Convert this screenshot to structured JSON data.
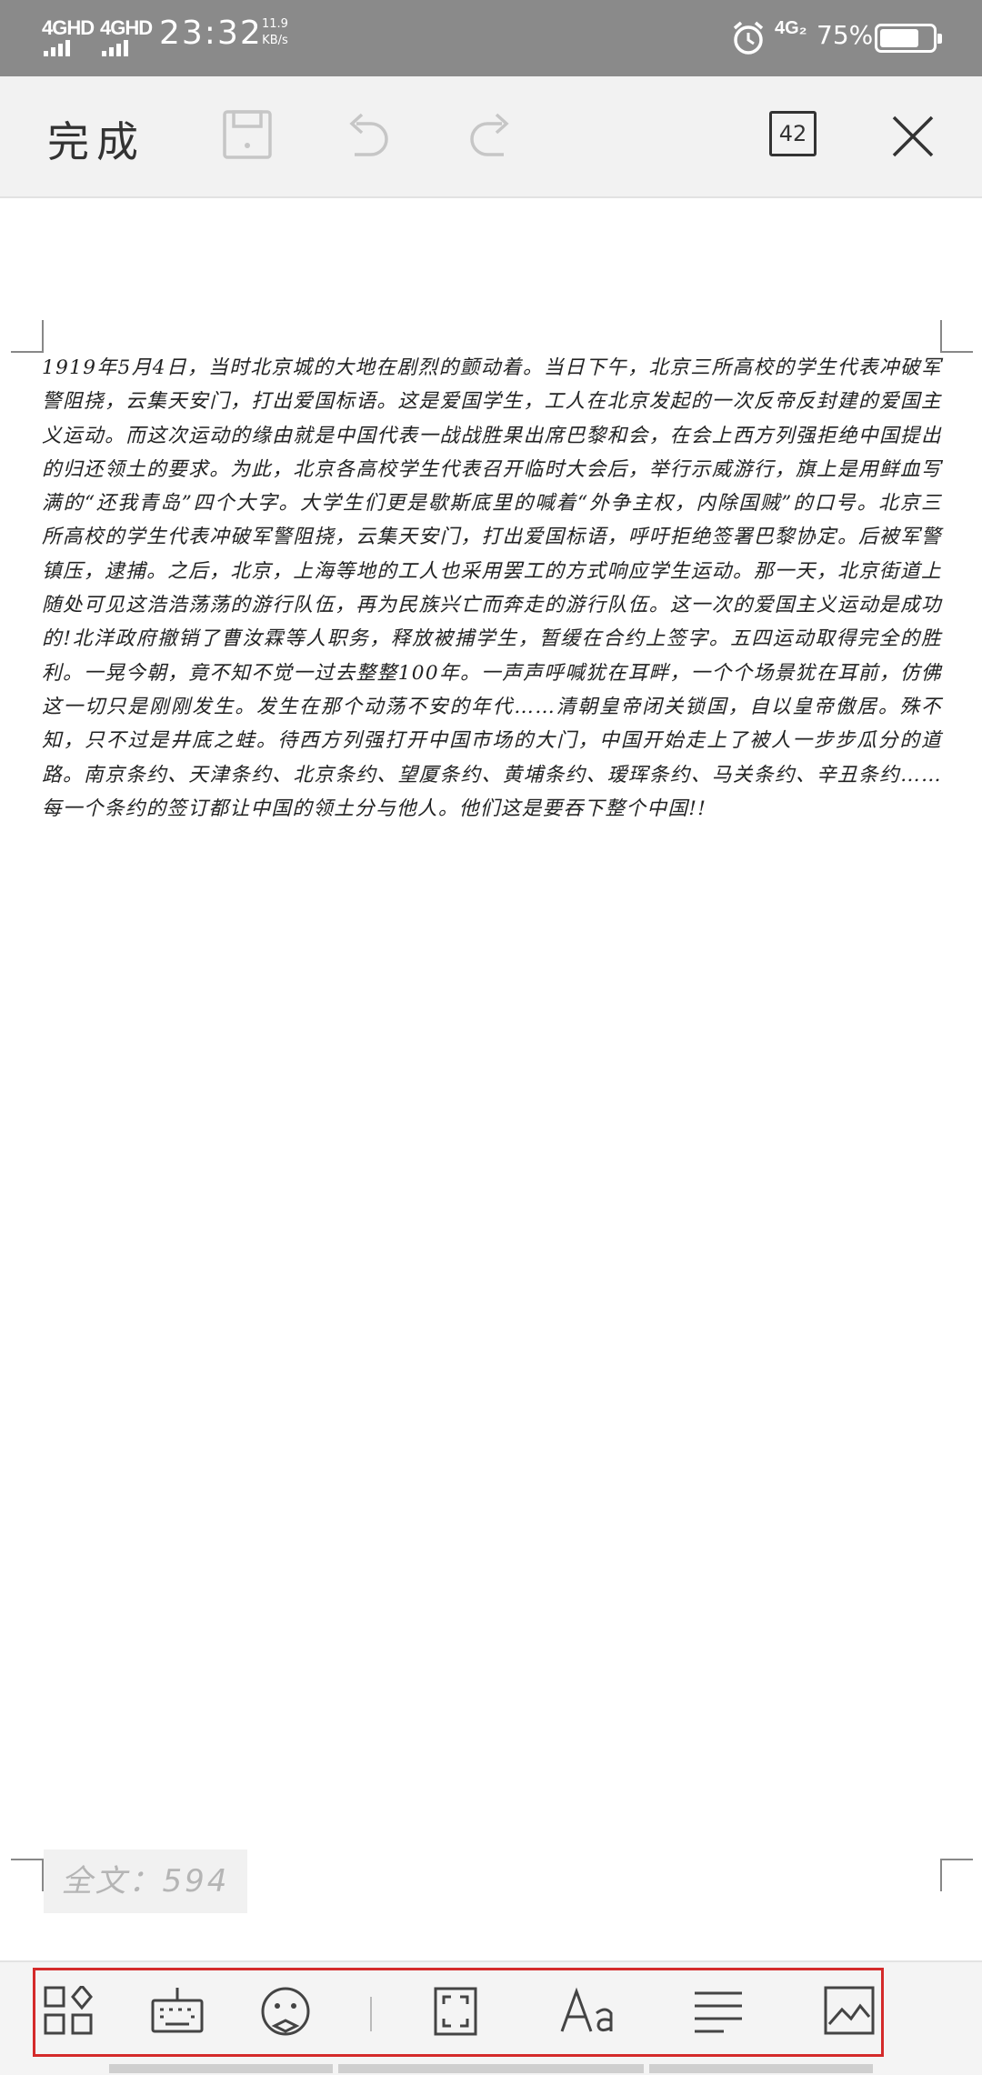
{
  "status_bar": {
    "net1": "4GHD",
    "net2": "4GHD",
    "time": "23:32",
    "speed_value": "11.9",
    "speed_unit": "KB/s",
    "sim2": "4G₂",
    "battery_text": "75%",
    "battery_level": 0.75
  },
  "toolbar": {
    "done_label": "完成",
    "count": "42"
  },
  "document": {
    "body": "1919年5月4日，当时北京城的大地在剧烈的颤动着。当日下午，北京三所高校的学生代表冲破军警阻挠，云集天安门，打出爱国标语。这是爱国学生，工人在北京发起的一次反帝反封建的爱国主义运动。而这次运动的缘由就是中国代表一战战胜果出席巴黎和会，在会上西方列强拒绝中国提出的归还领土的要求。为此，北京各高校学生代表召开临时大会后，举行示威游行，旗上是用鲜血写满的“还我青岛”四个大字。大学生们更是歇斯底里的喊着“外争主权，内除国贼”的口号。北京三所高校的学生代表冲破军警阻挠，云集天安门，打出爱国标语，呼吁拒绝签署巴黎协定。后被军警镇压，逮捕。之后，北京，上海等地的工人也采用罢工的方式响应学生运动。那一天，北京街道上随处可见这浩浩荡荡的游行队伍，再为民族兴亡而奔走的游行队伍。这一次的爱国主义运动是成功的!北洋政府撤销了曹汝霖等人职务，释放被捕学生，暂缓在合约上签字。五四运动取得完全的胜利。一晃今朝，竟不知不觉一过去整整100年。一声声呼喊犹在耳畔，一个个场景犹在耳前，仿佛这一切只是刚刚发生。发生在那个动荡不安的年代……清朝皇帝闭关锁国，自以皇帝傲居。殊不知，只不过是井底之蛙。待西方列强打开中国市场的大门，中国开始走上了被人一步步瓜分的道路。南京条约、天津条约、北京条约、望厦条约、黄埔条约、瑷珲条约、马关条约、辛丑条约……每一个条约的签订都让中国的领土分与他人。他们这是要吞下整个中国!!"
  },
  "word_count": {
    "label": "全文：594"
  },
  "bottom_toolbar": {
    "icons": [
      "apps-icon",
      "keyboard-icon",
      "sticker-icon",
      "fullscreen-icon",
      "font-icon",
      "align-icon",
      "image-icon"
    ]
  }
}
